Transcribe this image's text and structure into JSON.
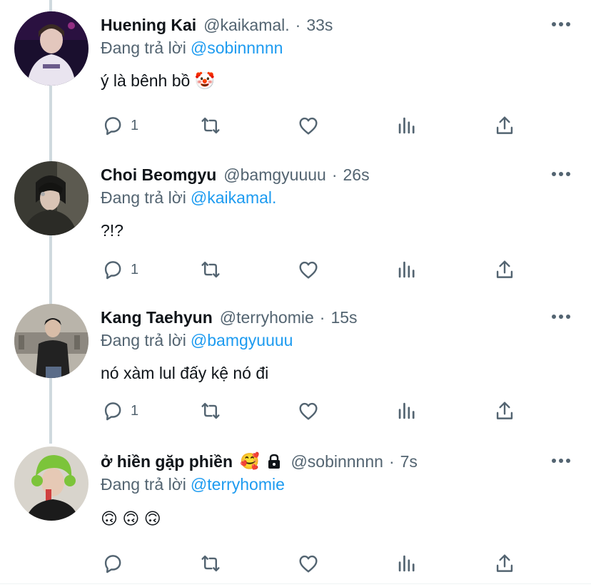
{
  "tweets": [
    {
      "display_name": "Huening Kai",
      "handle": "@kaikamal.",
      "separator": "·",
      "time": "33s",
      "reply_prefix": "Đang trả lời",
      "reply_to": "@sobinnnnn",
      "text": "ý là bênh bồ 🤡",
      "reply_count": "1",
      "avatar_colors": [
        "#1a0f2e",
        "#e9e4ef"
      ]
    },
    {
      "display_name": "Choi Beomgyu",
      "handle": "@bamgyuuuu",
      "separator": "·",
      "time": "26s",
      "reply_prefix": "Đang trả lời",
      "reply_to": "@kaikamal.",
      "text": "?!?",
      "reply_count": "1",
      "avatar_colors": [
        "#2b2b26",
        "#59594f"
      ]
    },
    {
      "display_name": "Kang Taehyun",
      "handle": "@terryhomie",
      "separator": "·",
      "time": "15s",
      "reply_prefix": "Đang trả lời",
      "reply_to": "@bamgyuuuu",
      "text": "nó xàm lul đấy kệ nó đi",
      "reply_count": "1",
      "avatar_colors": [
        "#b9b4aa",
        "#222222"
      ]
    },
    {
      "display_name": "ở hiền gặp phiền",
      "name_emoji": "🥰",
      "handle": "@sobinnnnn",
      "separator": "·",
      "time": "7s",
      "reply_prefix": "Đang trả lời",
      "reply_to": "@terryhomie",
      "text": "🙃 🙃 🙃",
      "reply_count": "",
      "avatar_colors": [
        "#d8d4cc",
        "#7cc43a"
      ]
    }
  ],
  "icons": {
    "more": "more-horizontal-icon",
    "reply": "reply-icon",
    "retweet": "retweet-icon",
    "like": "like-icon",
    "views": "analytics-icon",
    "share": "share-icon",
    "lock": "lock-icon"
  },
  "colors": {
    "text_primary": "#0f1419",
    "text_secondary": "#536471",
    "link": "#1d9bf0",
    "thread_line": "#cfd9de"
  }
}
